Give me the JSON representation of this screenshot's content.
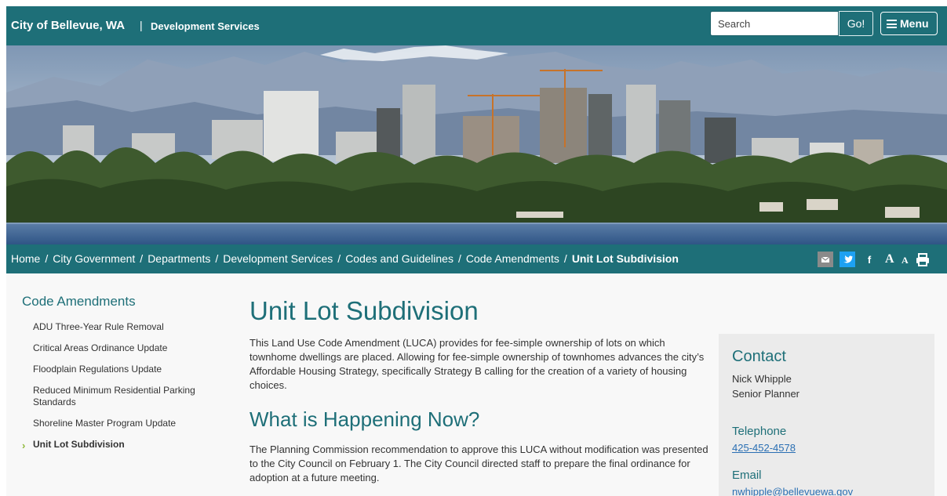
{
  "header": {
    "site_title": "City of Bellevue, WA",
    "separator": "|",
    "section": "Development Services",
    "search_placeholder": "Search",
    "go_label": "Go!",
    "menu_label": "Menu",
    "bg_color": "#1e6f78"
  },
  "breadcrumb": {
    "items": [
      "Home",
      "City Government",
      "Departments",
      "Development Services",
      "Codes and Guidelines",
      "Code Amendments"
    ],
    "current": "Unit Lot Subdivision",
    "separator": "/"
  },
  "tools": {
    "font_large": "A",
    "font_small": "A",
    "icons": [
      "mail-icon",
      "twitter-icon",
      "facebook-icon",
      "font-increase-icon",
      "font-decrease-icon",
      "print-icon"
    ],
    "facebook_glyph": "f"
  },
  "sidebar": {
    "title": "Code Amendments",
    "items": [
      {
        "label": "ADU Three-Year Rule Removal"
      },
      {
        "label": "Critical Areas Ordinance Update"
      },
      {
        "label": "Floodplain Regulations Update"
      },
      {
        "label": "Reduced Minimum Residential Parking Standards"
      },
      {
        "label": "Shoreline Master Program Update"
      },
      {
        "label": "Unit Lot Subdivision",
        "active": true
      }
    ],
    "active_marker": "›"
  },
  "main": {
    "title": "Unit Lot Subdivision",
    "intro": "This Land Use Code Amendment (LUCA) provides for fee-simple ownership of lots on which townhome dwellings are placed. Allowing for fee-simple ownership of townhomes advances the city’s Affordable Housing Strategy, specifically Strategy B calling for the creation of a variety of housing choices.",
    "section_heading": "What is Happening Now?",
    "section_text": "The Planning Commission recommendation to approve this LUCA without modification was presented to the City Council on February 1. The City Council directed staff to prepare the final ordinance for adoption at a future meeting."
  },
  "contact": {
    "title": "Contact",
    "name": "Nick Whipple",
    "role": "Senior Planner",
    "telephone_label": "Telephone",
    "telephone": "425-452-4578",
    "email_label": "Email",
    "email": "nwhipple@bellevuewa.gov"
  }
}
